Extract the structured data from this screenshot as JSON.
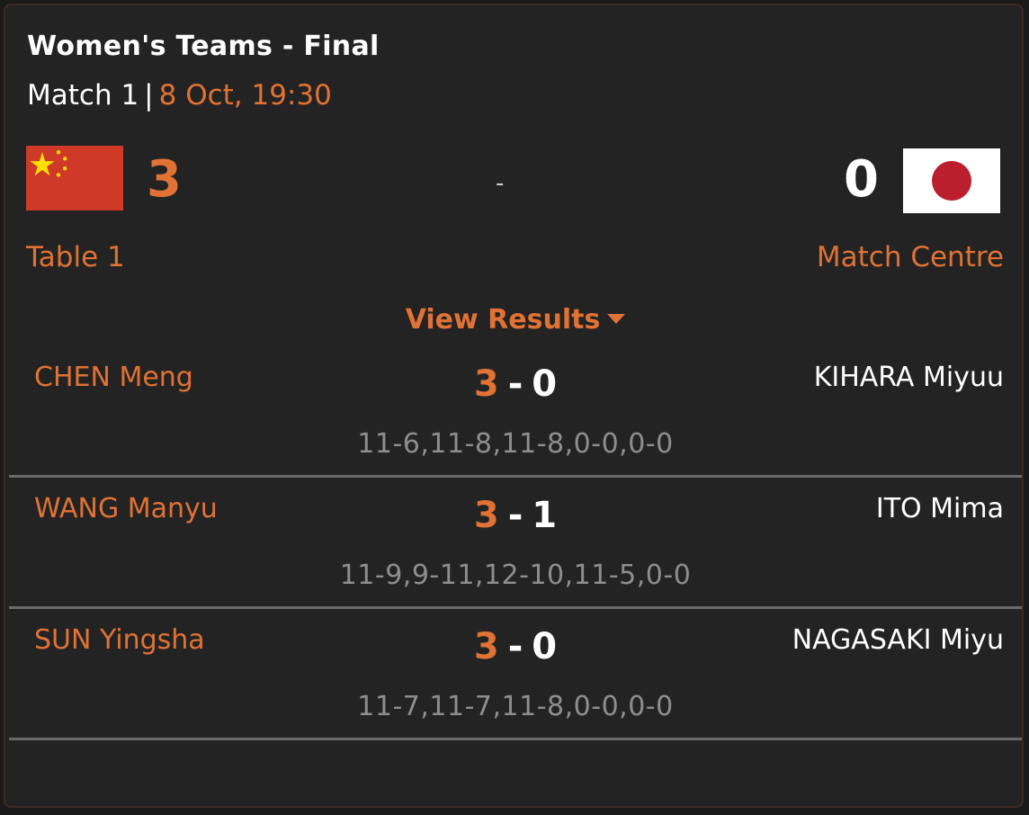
{
  "header": {
    "title": "Women's Teams - Final",
    "match_label": "Match 1",
    "separator": "|",
    "datetime": "8 Oct, 19:30"
  },
  "teams": {
    "home": {
      "flag": "china-flag",
      "score": "3"
    },
    "away": {
      "flag": "japan-flag",
      "score": "0"
    },
    "dash": "-"
  },
  "links": {
    "table": "Table 1",
    "match_centre": "Match Centre",
    "view_results": "View Results"
  },
  "matches": [
    {
      "home": "CHEN Meng",
      "home_score": "3",
      "dash": "-",
      "away_score": "0",
      "away": "KIHARA Miyuu",
      "games": "11-6,11-8,11-8,0-0,0-0"
    },
    {
      "home": "WANG Manyu",
      "home_score": "3",
      "dash": "-",
      "away_score": "1",
      "away": "ITO Mima",
      "games": "11-9,9-11,12-10,11-5,0-0"
    },
    {
      "home": "SUN Yingsha",
      "home_score": "3",
      "dash": "-",
      "away_score": "0",
      "away": "NAGASAKI Miyu",
      "games": "11-7,11-7,11-8,0-0,0-0"
    }
  ],
  "colors": {
    "accent": "#e07235",
    "background": "#232323",
    "muted": "#8e8e8e",
    "divider": "#6a6a6a"
  }
}
